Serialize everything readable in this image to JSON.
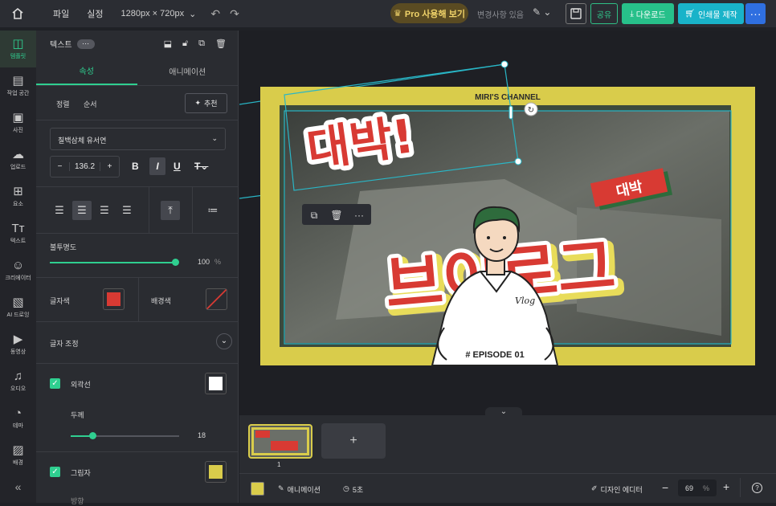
{
  "topbar": {
    "file": "파일",
    "settings": "실정",
    "canvas_size": "1280px × 720px",
    "pro_label": "Pro 사용해 보기",
    "changes": "변경사항 있음",
    "share": "공유",
    "download": "다운로드",
    "print": "인쇄물 제작",
    "more": "···"
  },
  "sidenav": {
    "items": [
      {
        "label": "템플릿",
        "icon": "template-icon"
      },
      {
        "label": "작업 공간",
        "icon": "workspace-icon"
      },
      {
        "label": "사진",
        "icon": "photo-icon"
      },
      {
        "label": "업로드",
        "icon": "upload-icon"
      },
      {
        "label": "요소",
        "icon": "elements-icon"
      },
      {
        "label": "텍스트",
        "icon": "text-icon"
      },
      {
        "label": "크리에이터",
        "icon": "creator-icon"
      },
      {
        "label": "AI 드로잉",
        "icon": "ai-drawing-icon"
      },
      {
        "label": "동영상",
        "icon": "video-icon"
      },
      {
        "label": "오디오",
        "icon": "audio-icon"
      },
      {
        "label": "테마",
        "icon": "theme-icon"
      },
      {
        "label": "배경",
        "icon": "background-icon"
      }
    ]
  },
  "panel": {
    "title": "텍스트",
    "tab_properties": "속성",
    "tab_animation": "애니메이션",
    "align_label": "정렬",
    "order_label": "순서",
    "recommend": "추천",
    "font_name": "칠백삼체 유서연",
    "font_size": "136.2",
    "opacity_label": "불투명도",
    "opacity_value": "100",
    "opacity_unit": "%",
    "text_color_label": "글자색",
    "bg_color_label": "배경색",
    "text_adjust_label": "글자 조정",
    "outline_label": "외곽선",
    "thickness_label": "두께",
    "thickness_value": "18",
    "shadow_label": "그림자",
    "direction_label": "방향"
  },
  "canvas": {
    "channel": "MIRI'S CHANNEL",
    "daebak_big": "대박!",
    "daebak_tag": "대박",
    "vlog_text": "브이로그",
    "shirt_text": "Vlog",
    "episode": "# EPISODE 01"
  },
  "bottom": {
    "page_number": "1",
    "animation": "애니메이션",
    "duration": "5초",
    "design_editor": "디자인 에디터",
    "zoom": "69",
    "zoom_unit": "%"
  },
  "colors": {
    "accent": "#2fcf90",
    "frame": "#d9cc4b",
    "text_red": "#d83a33",
    "bg_dark": "#1e1f24"
  }
}
